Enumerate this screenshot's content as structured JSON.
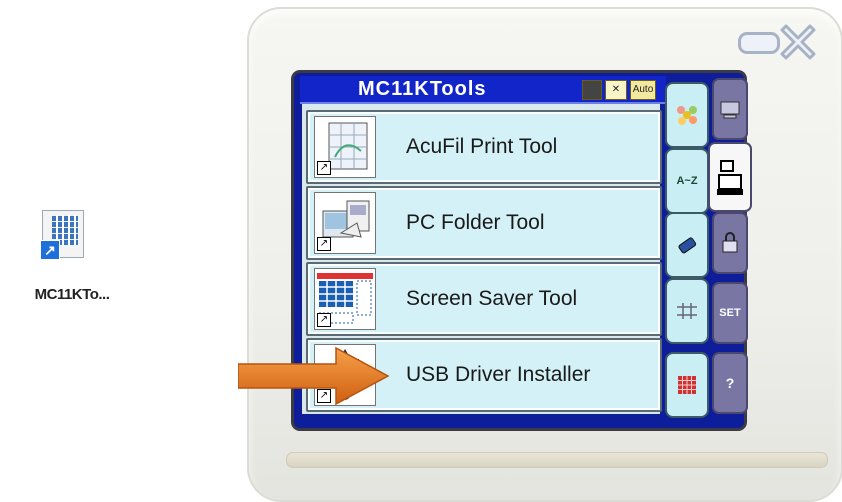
{
  "desktop": {
    "shortcut_label": "MC11KTo..."
  },
  "window": {
    "title": "MC11KTools",
    "title_icon_auto": "Auto"
  },
  "tools": [
    {
      "label": "AcuFil Print Tool",
      "icon": "print-grid-icon"
    },
    {
      "label": "PC Folder Tool",
      "icon": "pc-folder-icon"
    },
    {
      "label": "Screen Saver Tool",
      "icon": "screen-saver-icon"
    },
    {
      "label": "USB Driver Installer",
      "icon": "usb-icon"
    }
  ],
  "side_tabs": {
    "az_label": "A~Z",
    "set_label": "SET",
    "help_label": "?"
  },
  "colors": {
    "screen_blue": "#1225c8",
    "item_bg": "#d3f1f6",
    "tab_purple": "#7976a4",
    "arrow_orange": "#e07a22"
  }
}
